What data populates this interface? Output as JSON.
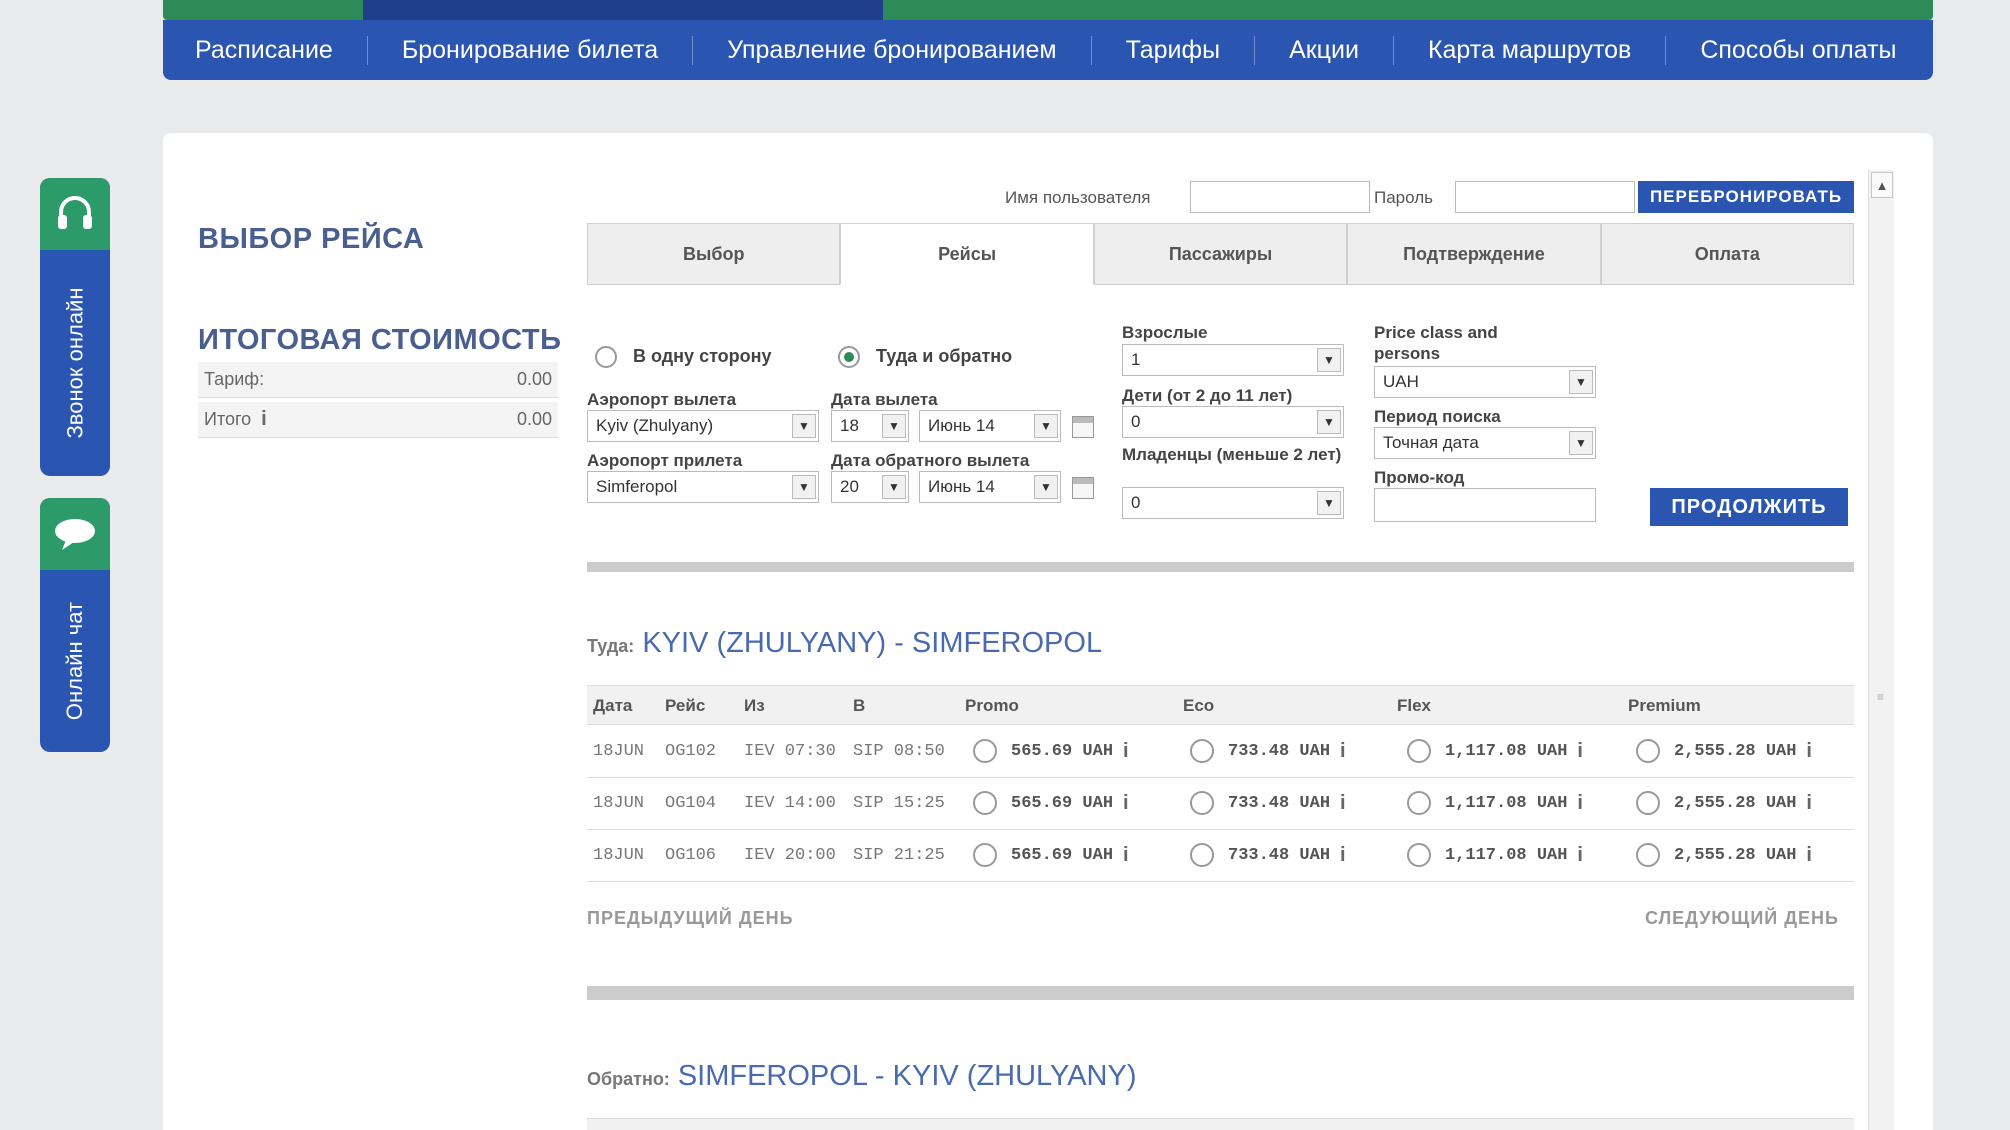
{
  "nav": {
    "items": [
      "Расписание",
      "Бронирование билета",
      "Управление бронированием",
      "Тарифы",
      "Акции",
      "Карта маршрутов",
      "Способы оплаты"
    ]
  },
  "widgets": {
    "call_label": "Звонок онлайн",
    "chat_label": "Онлайн чат"
  },
  "left": {
    "select_title": "ВЫБОР РЕЙСА",
    "total_title": "ИТОГОВАЯ СТОИМОСТЬ",
    "tariff_label": "Тариф:",
    "tariff_value": "0.00",
    "total_label": "Итого",
    "total_value": "0.00"
  },
  "login": {
    "username_label": "Имя пользователя",
    "username_value": "",
    "password_label": "Пароль",
    "password_value": "",
    "rebook_button": "ПЕРЕБРОНИРОВАТЬ"
  },
  "steps": [
    "Выбор",
    "Рейсы",
    "Пассажиры",
    "Подтверждение",
    "Оплата"
  ],
  "search": {
    "one_way_label": "В одну сторону",
    "round_trip_label": "Туда и обратно",
    "trip_type_selected": "round_trip",
    "departure_airport_label": "Аэропорт вылета",
    "departure_airport": "Kyiv (Zhulyany)",
    "arrival_airport_label": "Аэропорт прилета",
    "arrival_airport": "Simferopol",
    "departure_date_label": "Дата вылета",
    "departure_day": "18",
    "departure_month": "Июнь 14",
    "return_date_label": "Дата обратного вылета",
    "return_day": "20",
    "return_month": "Июнь 14",
    "adults_label": "Взрослые",
    "adults": "1",
    "children_label": "Дети (от 2 до 11 лет)",
    "children": "0",
    "infants_label": "Младенцы (меньше 2 лет)",
    "infants": "0",
    "price_class_label": "Price class and persons",
    "price_class": "UAH",
    "search_period_label": "Период поиска",
    "search_period": "Точная дата",
    "promo_label": "Промо-код",
    "promo_value": "",
    "continue_button": "ПРОДОЛЖИТЬ"
  },
  "outbound": {
    "dir_label": "Туда:",
    "route": "KYIV (ZHULYANY) - SIMFEROPOL",
    "headers": [
      "Дата",
      "Рейс",
      "Из",
      "В",
      "Promo",
      "Eco",
      "Flex",
      "Premium"
    ],
    "rows": [
      {
        "date": "18JUN",
        "flight": "OG102",
        "from": "IEV 07:30",
        "to": "SIP 08:50",
        "promo": "565.69 UAH",
        "eco": "733.48 UAH",
        "flex": "1,117.08 UAH",
        "premium": "2,555.28 UAH"
      },
      {
        "date": "18JUN",
        "flight": "OG104",
        "from": "IEV 14:00",
        "to": "SIP 15:25",
        "promo": "565.69 UAH",
        "eco": "733.48 UAH",
        "flex": "1,117.08 UAH",
        "premium": "2,555.28 UAH"
      },
      {
        "date": "18JUN",
        "flight": "OG106",
        "from": "IEV 20:00",
        "to": "SIP 21:25",
        "promo": "565.69 UAH",
        "eco": "733.48 UAH",
        "flex": "1,117.08 UAH",
        "premium": "2,555.28 UAH"
      }
    ],
    "prev_day": "ПРЕДЫДУЩИЙ ДЕНЬ",
    "next_day": "СЛЕДУЮЩИЙ ДЕНЬ"
  },
  "return": {
    "dir_label": "Обратно:",
    "route": "SIMFEROPOL - KYIV (ZHULYANY)"
  },
  "colors": {
    "nav_blue": "#2a55b0",
    "nav_green": "#2e8b57",
    "title_text": "#4a5f8f",
    "route_text": "#4a6ab0"
  },
  "icons": {
    "call": "headset-icon",
    "chat": "speech-bubble-icon",
    "calendar": "calendar-icon",
    "info": "info-icon",
    "dropdown": "chevron-down-icon"
  }
}
